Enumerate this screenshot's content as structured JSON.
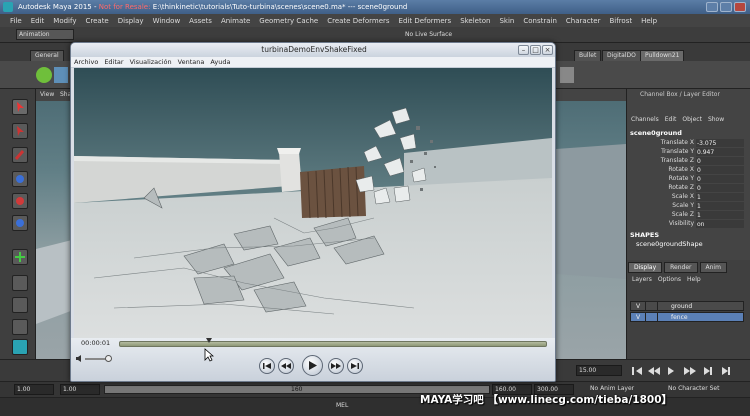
{
  "maya": {
    "title_app": "Autodesk Maya 2015 - ",
    "title_warning": "Not for Resale: ",
    "title_path": "E:\\thinkinetic\\tutorials\\Tuto-turbina\\scenes\\scene0.ma*  ---  scene0ground",
    "menu": [
      "File",
      "Edit",
      "Modify",
      "Create",
      "Display",
      "Window",
      "Assets",
      "Animate",
      "Geometry Cache",
      "Create Deformers",
      "Edit Deformers",
      "Skeleton",
      "Skin",
      "Constrain",
      "Character",
      "Bifrost",
      "Help"
    ],
    "mode": "Animation",
    "live_surface": "No Live Surface",
    "shelf_tabs": [
      "General",
      "Bullet",
      "DigitalDO",
      "Pulldown21"
    ],
    "viewport_menu": [
      "View",
      "Sha"
    ]
  },
  "channel_box": {
    "title": "Channel Box / Layer Editor",
    "tabs": [
      "Channels",
      "Edit",
      "Object",
      "Show"
    ],
    "object": "scene0ground",
    "attributes": [
      {
        "label": "Translate X",
        "value": "-3.075"
      },
      {
        "label": "Translate Y",
        "value": "0.947"
      },
      {
        "label": "Translate Z",
        "value": "0"
      },
      {
        "label": "Rotate X",
        "value": "0"
      },
      {
        "label": "Rotate Y",
        "value": "0"
      },
      {
        "label": "Rotate Z",
        "value": "0"
      },
      {
        "label": "Scale X",
        "value": "1"
      },
      {
        "label": "Scale Y",
        "value": "1"
      },
      {
        "label": "Scale Z",
        "value": "1"
      },
      {
        "label": "Visibility",
        "value": "on"
      }
    ],
    "shapes_header": "SHAPES",
    "shape_name": "scene0groundShape"
  },
  "layer_editor": {
    "tabs": [
      "Display",
      "Render",
      "Anim"
    ],
    "menu": [
      "Layers",
      "Options",
      "Help"
    ],
    "layers": [
      {
        "visible": "V",
        "name": "ground"
      },
      {
        "visible": "V",
        "name": "fence"
      }
    ]
  },
  "timeline": {
    "current_frame": "15.00",
    "range_start": "1.00",
    "range_start_2": "1.00",
    "range_inner_end": "160",
    "range_end": "160.00",
    "anim_end": "300.00",
    "anim_layer": "No Anim Layer",
    "character_set": "No Character Set",
    "cmd_label": "MEL"
  },
  "player": {
    "title": "turbinaDemoEnvShakeFixed",
    "menu": [
      "Archivo",
      "Editar",
      "Visualización",
      "Ventana",
      "Ayuda"
    ],
    "time": "00:00:01",
    "progress_fraction": 0.21
  },
  "watermark": "MAYA学习吧 【www.linecg.com/tieba/1800】"
}
